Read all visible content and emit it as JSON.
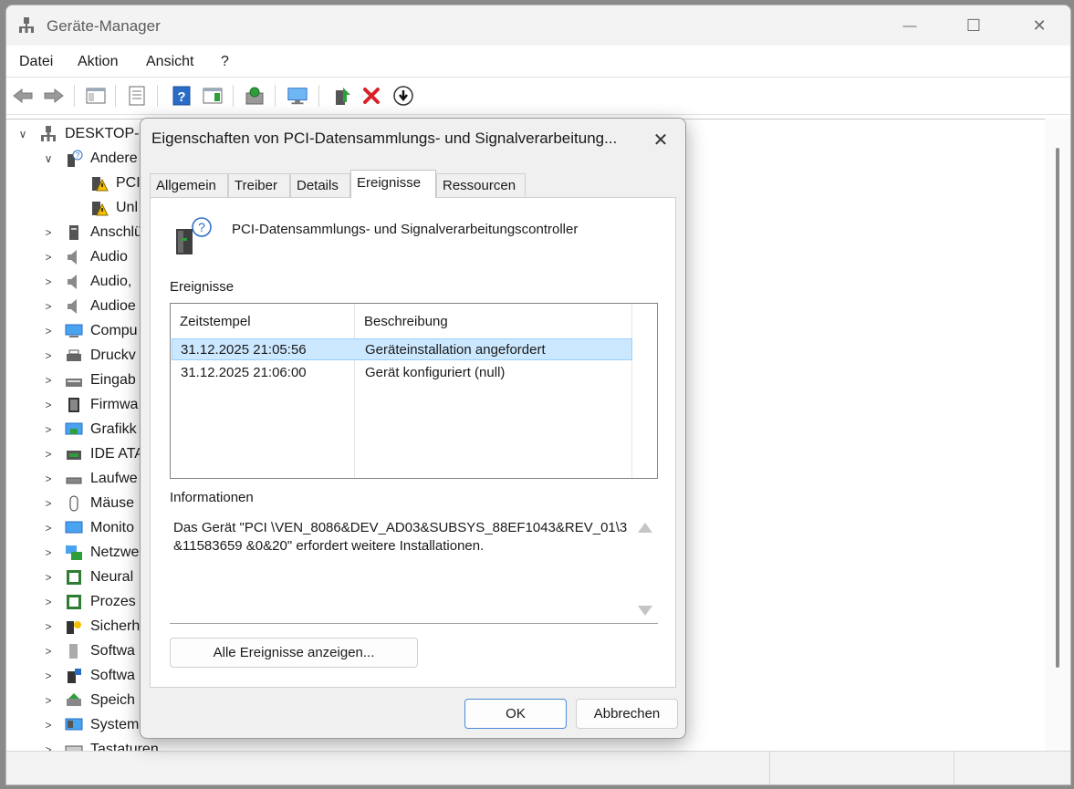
{
  "window": {
    "title": "Geräte-Manager",
    "controls": {
      "minimize": "—",
      "maximize": "☐",
      "close": "✕"
    }
  },
  "menu": [
    "Datei",
    "Aktion",
    "Ansicht",
    "?"
  ],
  "toolbar": {
    "icons": [
      "back-arrow-icon",
      "forward-arrow-icon",
      "show-hide-console-tree-icon",
      "properties-icon",
      "help-icon",
      "action-pane-icon",
      "scan-hardware-icon",
      "monitor-icon",
      "update-driver-icon",
      "uninstall-icon",
      "disable-device-icon"
    ],
    "colors": {
      "green": "#2e9e3a",
      "red": "#d8222a",
      "blue": "#2a6cc6"
    }
  },
  "tree": {
    "root": "DESKTOP-",
    "other_group": "Andere",
    "other_children": [
      "PCI",
      "Unl"
    ],
    "categories": [
      "Anschlü",
      "Audio",
      "Audio,",
      "Audioe",
      "Compu",
      "Druckv",
      "Eingab",
      "Firmwa",
      "Grafikk",
      "IDE ATA",
      "Laufwe",
      "Mäuse",
      "Monito",
      "Netzwe",
      "Neural",
      "Prozes",
      "Sicherh",
      "Softwa",
      "Softwa",
      "Speich",
      "System",
      "Tastaturen"
    ]
  },
  "dialog": {
    "title": "Eigenschaften von PCI-Datensammlungs- und Signalverarbeitung...",
    "close_glyph": "✕",
    "tabs": [
      "Allgemein",
      "Treiber",
      "Details",
      "Ereignisse",
      "Ressourcen"
    ],
    "active_tab": "Ereignisse",
    "device_name": "PCI-Datensammlungs- und Signalverarbeitungscontroller",
    "events_label": "Ereignisse",
    "columns": [
      "Zeitstempel",
      "Beschreibung"
    ],
    "events": [
      {
        "timestamp": "31.12.2025 21:05:56",
        "description": "Geräteinstallation angefordert",
        "selected": true
      },
      {
        "timestamp": "31.12.2025 21:06:00",
        "description": "Gerät konfiguriert (null)",
        "selected": false
      }
    ],
    "info_label": "Informationen",
    "info_text": "Das Gerät \"PCI \\VEN_8086&DEV_AD03&SUBSYS_88EF1043&REV_01\\3&11583659 &0&20\" erfordert weitere Installationen.",
    "show_all_button": "Alle Ereignisse anzeigen...",
    "ok_button": "OK",
    "cancel_button": "Abbrechen",
    "accent_color": "#0067c0",
    "selection_color": "#cce8ff"
  }
}
